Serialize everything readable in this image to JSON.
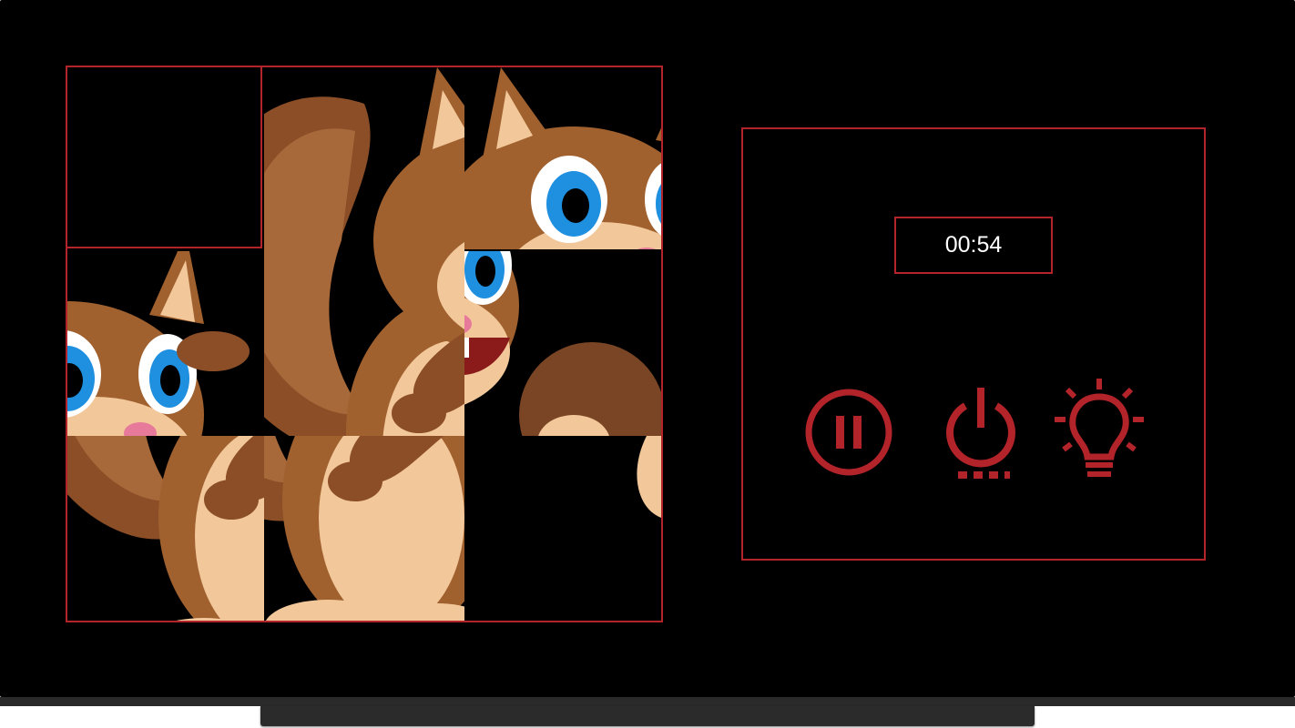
{
  "timer": {
    "value": "00:54"
  },
  "controls": {
    "pause": {
      "icon": "pause-circle-icon"
    },
    "power": {
      "icon": "power-icon"
    },
    "hint": {
      "icon": "lightbulb-icon"
    }
  },
  "colors": {
    "accent": "#b3242a",
    "background": "#000000",
    "fur_dark": "#7a4524",
    "fur_mid": "#a0612f",
    "fur_light": "#f2c79a",
    "eye_blue": "#1f8fe0"
  }
}
